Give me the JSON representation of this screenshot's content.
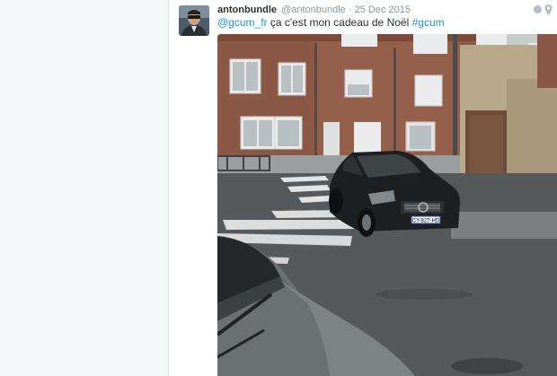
{
  "tweet": {
    "display_name": "antonbundle",
    "handle": "@antonbundle",
    "separator": "·",
    "date": "25 Dec 2015",
    "text_mention": "@gcum_fr",
    "text_body": " ça c'est mon cadeau de Noël ",
    "text_hashtag": "#gcum"
  },
  "photo": {
    "license_plate": "CY-827-HD"
  },
  "icons": {
    "globe": "globe-icon",
    "location": "location-pin-icon"
  },
  "colors": {
    "link": "#1b95e0",
    "name": "#292f33",
    "meta": "#8899a6"
  }
}
